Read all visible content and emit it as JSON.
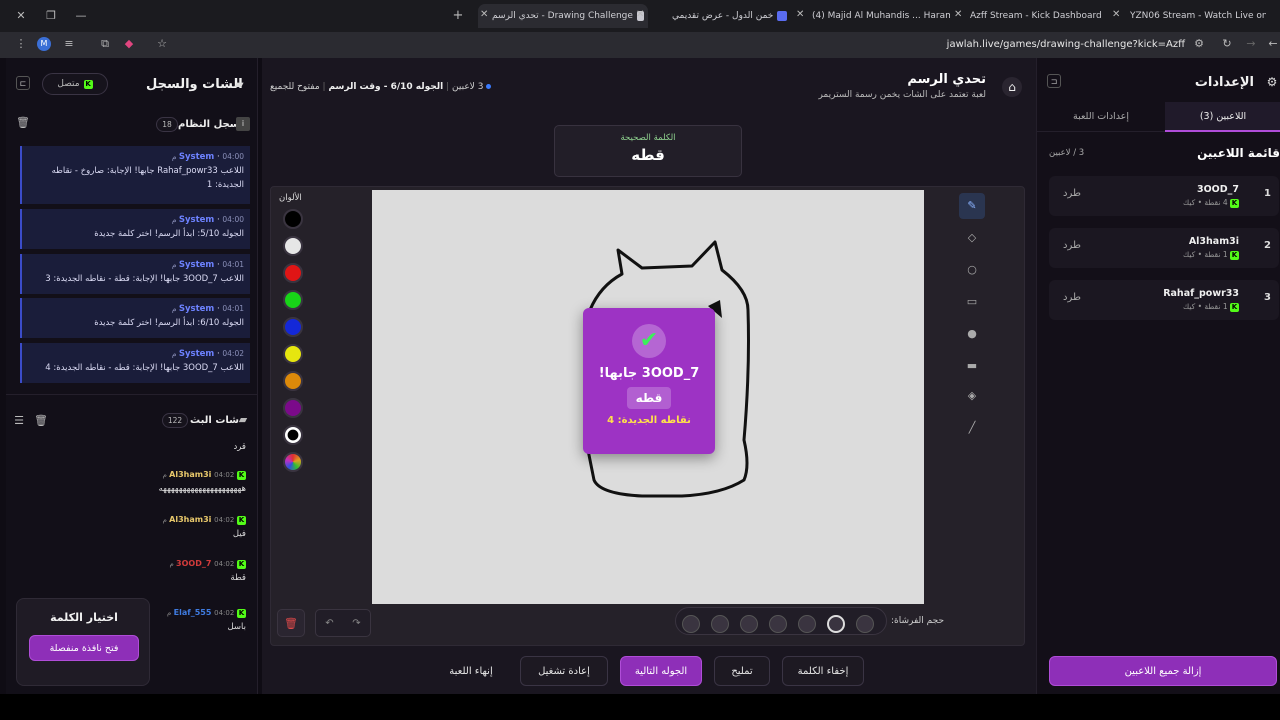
{
  "browser": {
    "tabs": [
      {
        "title": "تحدي الرسم - Drawing Challenge",
        "active": true
      },
      {
        "title": "خمن الدول - عرض تقديمي"
      },
      {
        "title": "(4) Majid Al Muhandis ... Haram"
      },
      {
        "title": "Azff Stream - Kick Dashboard"
      },
      {
        "title": "YZN06 Stream - Watch Live on"
      }
    ],
    "url": "jawlah.live/games/drawing-challenge?kick=Azff",
    "profile_letter": "M"
  },
  "chat_panel": {
    "title": "الشات والسجل",
    "status": "متصل",
    "system_log": {
      "title": "سجل النظام",
      "count": "18"
    },
    "system_messages": [
      {
        "sender": "System",
        "time": "04:00 م",
        "text": "اللاعب Rahaf_powr33 جابها! الإجابة: صاروخ - نقاطه الجديدة: 1"
      },
      {
        "sender": "System",
        "time": "04:00 م",
        "text": "الجوله 5/10: ابدأ الرسم! اختر كلمة جديدة"
      },
      {
        "sender": "System",
        "time": "04:01 م",
        "text": "اللاعب 3OOD_7 جابها! الإجابة: قطة - نقاطه الجديدة: 3"
      },
      {
        "sender": "System",
        "time": "04:01 م",
        "text": "الجوله 6/10: ابدأ الرسم! اختر كلمة جديدة"
      },
      {
        "sender": "System",
        "time": "04:02 م",
        "text": "اللاعب 3OOD_7 جابها! الإجابة: قطه - نقاطه الجديدة: 4"
      }
    ],
    "stream_chat": {
      "title": "شات البث",
      "count": "122"
    },
    "chat_messages": [
      {
        "user": "",
        "time": "",
        "text": "قرد",
        "color": ""
      },
      {
        "user": "Al3ham3i",
        "time": "04:02 م",
        "text": "هههههههههههههههههههههه",
        "color": "#e8c86b"
      },
      {
        "user": "Al3ham3i",
        "time": "04:02 م",
        "text": "فيل",
        "color": "#e8c86b"
      },
      {
        "user": "3OOD_7",
        "time": "04:02 م",
        "text": "قطة",
        "color": "#d23b3b"
      },
      {
        "user": "Elaf_555",
        "time": "04:02 م",
        "text": "باسل",
        "color": "#3f7be0"
      }
    ],
    "word_choice": {
      "title": "اختيار الكلمة",
      "button": "فتح نافذة منفصلة"
    }
  },
  "game": {
    "title": "تحدي الرسم",
    "subtitle": "لعبة تعتمد على الشات يخمن رسمة الستريمر",
    "players_count": "3 لاعبين",
    "round_info": "الجوله 6/10 - وقت الرسم",
    "open_label": "مفتوح للجميع",
    "correct_word_label": "الكلمة الصحيحة",
    "correct_word": "قطه",
    "colors_label": "الألوان",
    "colors": [
      "#000000",
      "#e6e6e6",
      "#e01515",
      "#18d418",
      "#1428d8",
      "#e6e60f",
      "#dd8a0a",
      "#7b0a8a",
      "#000000",
      "#e05020"
    ],
    "brush_label": "حجم الفرشاة:",
    "popup": {
      "winner": "3OOD_7 جابها!",
      "word": "قطه",
      "points": "نقاطه الجديدة: 4"
    },
    "actions": {
      "hide_word": "إخفاء الكلمة",
      "hint": "تمليح",
      "next_round": "الجوله التالية",
      "restart": "إعادة تشغيل",
      "end": "إنهاء اللعبة"
    }
  },
  "settings": {
    "title": "الإعدادات",
    "tab_players": "اللاعبين (3)",
    "tab_game": "إعدادات اللعبة",
    "list_title": "قائمة اللاعبين",
    "list_count": "3 / لاعبين",
    "kick_label": "طرد",
    "players": [
      {
        "rank": "1",
        "name": "3OOD_7",
        "meta": "4 نقطة • كيك"
      },
      {
        "rank": "2",
        "name": "Al3ham3i",
        "meta": "1 نقطة • كيك"
      },
      {
        "rank": "3",
        "name": "Rahaf_powr33",
        "meta": "1 نقطة • كيك"
      }
    ],
    "remove_all": "إزالة جميع اللاعبين"
  }
}
